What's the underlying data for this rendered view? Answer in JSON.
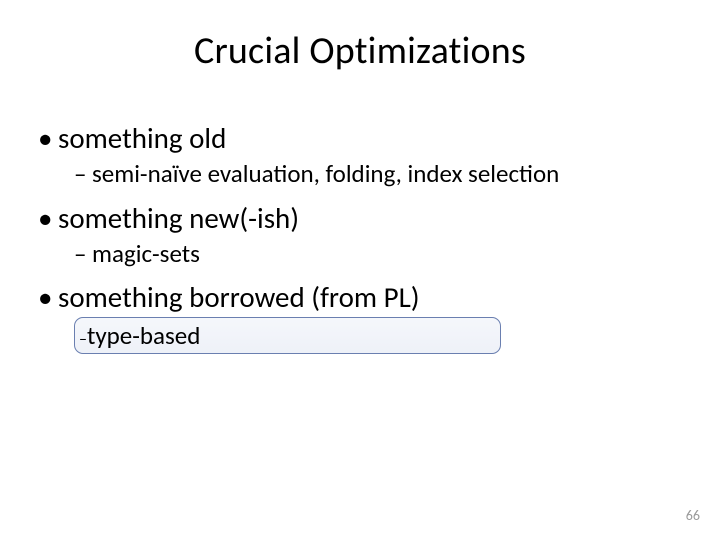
{
  "title": "Crucial Optimizations",
  "items": [
    {
      "label": "something old",
      "sub": [
        {
          "label": "semi-naïve evaluation, folding, index selection",
          "highlight": false
        }
      ]
    },
    {
      "label": "something new(-ish)",
      "sub": [
        {
          "label": "magic-sets",
          "highlight": false
        }
      ]
    },
    {
      "label": "something borrowed (from PL)",
      "sub": [
        {
          "label": "type-based",
          "highlight": true
        }
      ]
    }
  ],
  "page_number": "66"
}
